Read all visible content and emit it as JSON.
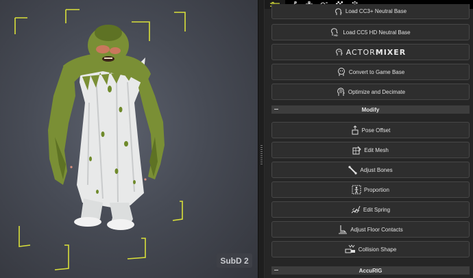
{
  "viewport": {
    "subd_label": "SubD 2"
  },
  "panel": {
    "tabs": [
      {
        "icon": "sliders-icon",
        "active": true
      },
      {
        "icon": "running-figure-icon"
      },
      {
        "icon": "pose-figure-icon"
      },
      {
        "icon": "morph-icon"
      },
      {
        "icon": "checkerboard-icon"
      },
      {
        "icon": "gear-icon"
      }
    ],
    "top_buttons": [
      {
        "label": "Load CC3+ Neutral Base",
        "icon": "head-icon"
      },
      {
        "label": "Load CC5 HD Neutral Base",
        "icon": "head-hd-icon"
      },
      {
        "label": "ACTORMIXER",
        "icon": "actormixer-icon"
      },
      {
        "label": "Convert to Game Base",
        "icon": "game-head-icon"
      },
      {
        "label": "Optimize and Decimate",
        "icon": "optimize-head-icon"
      }
    ],
    "actormixer": {
      "part1": "ACTOR",
      "part2": "MIXER"
    },
    "modify_section": {
      "title": "Modify",
      "buttons": [
        {
          "label": "Pose Offset",
          "icon": "pose-offset-icon"
        },
        {
          "label": "Edit Mesh",
          "icon": "edit-mesh-icon"
        },
        {
          "label": "Adjust Bones",
          "icon": "bones-icon"
        },
        {
          "label": "Proportion",
          "icon": "proportion-icon"
        },
        {
          "label": "Edit Spring",
          "icon": "spring-icon"
        },
        {
          "label": "Adjust Floor Contacts",
          "icon": "floor-contact-icon"
        },
        {
          "label": "Collision Shape",
          "icon": "collision-shape-icon"
        }
      ]
    },
    "accurig_section": {
      "title": "AccuRIG"
    }
  },
  "colors": {
    "viewport_bg": "#474b55",
    "corner_marks": "#d9e03a",
    "creature_skin": "#7a8f35",
    "robe": "#e9eaea",
    "panel_bg": "#262626",
    "button_bg": "#2e2e2e",
    "section_bg": "#3d3d3d"
  }
}
